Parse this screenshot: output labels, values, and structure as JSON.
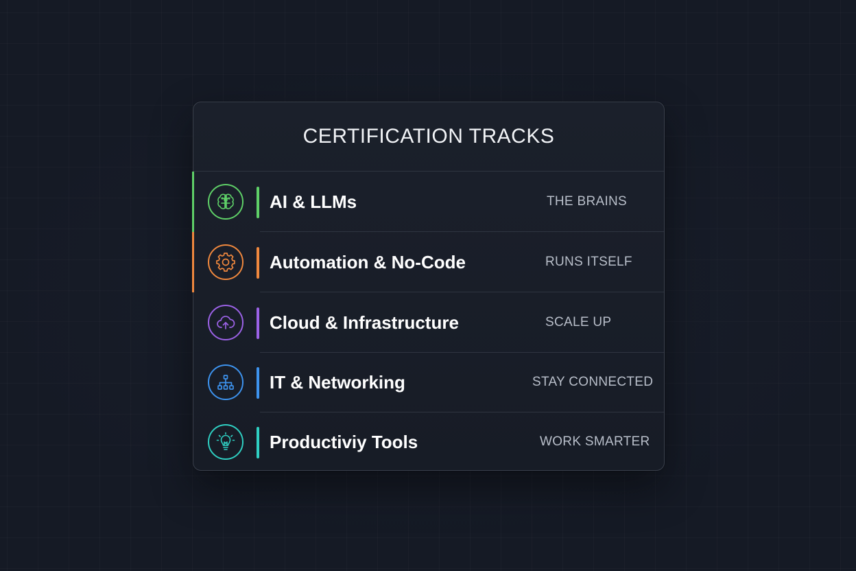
{
  "panel": {
    "title": "CERTIFICATION TRACKS"
  },
  "tracks": [
    {
      "title": "AI & LLMs",
      "tag": "THE BRAINS",
      "icon": "brain-icon",
      "color": "#5fd068"
    },
    {
      "title": "Automation & No-Code",
      "tag": "RUNS ITSELF",
      "icon": "gear-icon",
      "color": "#f0883e"
    },
    {
      "title": "Cloud & Infrastructure",
      "tag": "SCALE UP",
      "icon": "cloud-upload-icon",
      "color": "#9b62e6"
    },
    {
      "title": "IT & Networking",
      "tag": "STAY CONNECTED",
      "icon": "network-icon",
      "color": "#3d93ee"
    },
    {
      "title": "Productiviy Tools",
      "tag": "WORK SMARTER",
      "icon": "lightbulb-icon",
      "color": "#2fcfc2"
    }
  ]
}
